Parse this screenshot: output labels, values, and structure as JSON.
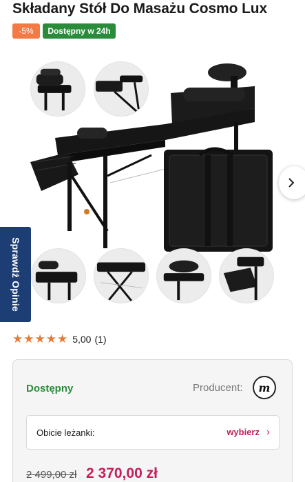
{
  "product": {
    "title": "Składany Stół Do Masażu Cosmo Lux",
    "badges": {
      "discount": "-5%",
      "availability": "Dostępny w 24h"
    }
  },
  "gallery": {
    "thumbnails": [
      "headrest",
      "side-armrest",
      "bolsters",
      "base-frame",
      "head-cushion",
      "arm-pad"
    ],
    "next_icon": "chevron-right-icon"
  },
  "side_tab": {
    "label": "Sprawdź Opinie"
  },
  "rating": {
    "stars": "★★★★★",
    "value": "5,00",
    "count": "(1)",
    "star_color": "#e57a36"
  },
  "purchase": {
    "stock_status": "Dostępny",
    "producer_label": "Producent:",
    "producer_logo_letter": "m",
    "option_label": "Obicie leżanki:",
    "option_action": "wybierz",
    "option_chevron": "›",
    "old_price": "2 499,00 zł",
    "new_price": "2 370,00 zł"
  },
  "colors": {
    "accent": "#c21f5b",
    "success": "#2a8c3a",
    "discount": "#f47a45",
    "side_tab": "#1d3d75"
  }
}
